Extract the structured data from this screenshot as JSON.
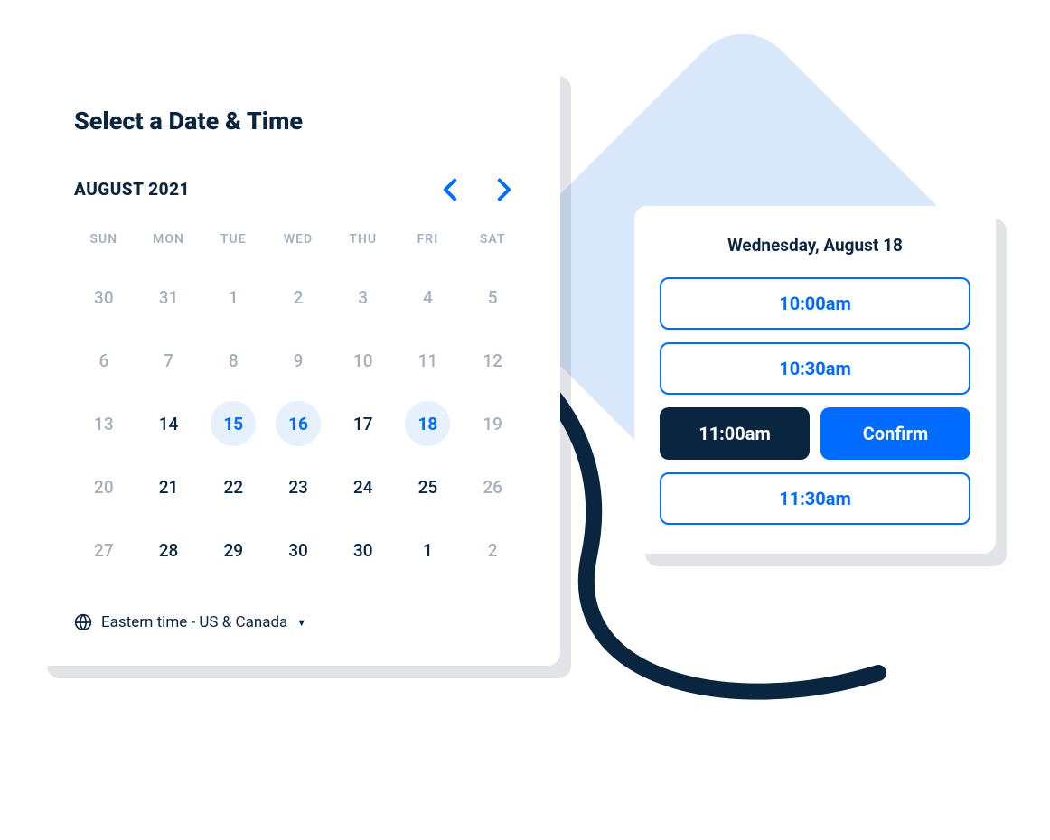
{
  "calendar": {
    "title": "Select a Date & Time",
    "month_label": "AUGUST 2021",
    "day_headers": [
      "SUN",
      "MON",
      "TUE",
      "WED",
      "THU",
      "FRI",
      "SAT"
    ],
    "days": [
      {
        "num": "30",
        "state": "muted"
      },
      {
        "num": "31",
        "state": "muted"
      },
      {
        "num": "1",
        "state": "muted"
      },
      {
        "num": "2",
        "state": "muted"
      },
      {
        "num": "3",
        "state": "muted"
      },
      {
        "num": "4",
        "state": "muted"
      },
      {
        "num": "5",
        "state": "muted"
      },
      {
        "num": "6",
        "state": "muted"
      },
      {
        "num": "7",
        "state": "muted"
      },
      {
        "num": "8",
        "state": "muted"
      },
      {
        "num": "9",
        "state": "muted"
      },
      {
        "num": "10",
        "state": "muted"
      },
      {
        "num": "11",
        "state": "muted"
      },
      {
        "num": "12",
        "state": "muted"
      },
      {
        "num": "13",
        "state": "muted"
      },
      {
        "num": "14",
        "state": "active"
      },
      {
        "num": "15",
        "state": "available"
      },
      {
        "num": "16",
        "state": "available"
      },
      {
        "num": "17",
        "state": "active"
      },
      {
        "num": "18",
        "state": "available"
      },
      {
        "num": "19",
        "state": "muted"
      },
      {
        "num": "20",
        "state": "muted"
      },
      {
        "num": "21",
        "state": "active"
      },
      {
        "num": "22",
        "state": "active"
      },
      {
        "num": "23",
        "state": "active"
      },
      {
        "num": "24",
        "state": "active"
      },
      {
        "num": "25",
        "state": "active"
      },
      {
        "num": "26",
        "state": "muted"
      },
      {
        "num": "27",
        "state": "muted"
      },
      {
        "num": "28",
        "state": "active"
      },
      {
        "num": "29",
        "state": "active"
      },
      {
        "num": "30",
        "state": "active"
      },
      {
        "num": "30",
        "state": "active"
      },
      {
        "num": "1",
        "state": "active"
      },
      {
        "num": "2",
        "state": "muted"
      }
    ],
    "timezone_label": "Eastern time - US & Canada"
  },
  "time_picker": {
    "selected_date": "Wednesday, August 18",
    "slots": [
      {
        "label": "10:00am",
        "selected": false
      },
      {
        "label": "10:30am",
        "selected": false
      },
      {
        "label": "11:00am",
        "selected": true
      },
      {
        "label": "11:30am",
        "selected": false
      }
    ],
    "confirm_label": "Confirm"
  }
}
